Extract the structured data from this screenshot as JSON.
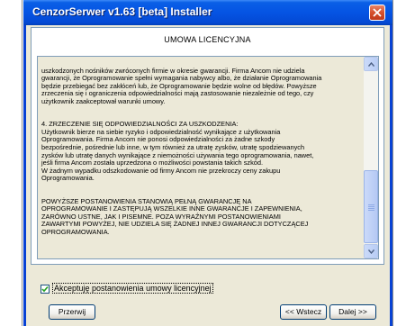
{
  "window": {
    "title": "CenzorSerwer v1.63 [beta] Installer",
    "close_icon": "close-icon"
  },
  "panel": {
    "heading": "UMOWA LICENCYJNA"
  },
  "license": {
    "paragraphs": [
      "uszkodzonych nośników zwróconych firmie w okresie gwarancji. Firma Ancom nie udziela\ngwarancji, że Oprogramowanie spełni wymagania nabywcy albo, że działanie Oprogramowania\nbędzie przebiegać bez zakłóceń lub, że Oprogramowanie będzie wolne od błędów. Powyższe\nzrzeczenia się i ograniczenia odpowiedzialności mają zastosowanie niezależnie od tego, czy\nużytkownik zaakceptował warunki umowy.",
      "4. ZRZECZENIE SIĘ ODPOWIEDZIALNOŚCI ZA USZKODZENIA:\nUżytkownik bierze na siebie ryzyko i odpowiedzialność wynikające z użytkowania\nOprogramowania. Firma Ancom nie ponosi odpowiedzialności za żadne szkody\nbezpośrednie, pośrednie lub inne, w tym również za utratę zysków, utratę spodziewanych\nzysków lub utratę danych wynikające z niemożności używania tego oprogramowania, nawet,\njeśli firma Ancom została uprzedzona o możliwości powstania takich szkód.\nW żadnym wypadku odszkodowanie od firmy Ancom nie przekroczy ceny zakupu\nOprogramowania.",
      "POWYŻSZE POSTANOWIENIA STANOWIĄ PEŁNĄ GWARANCJĘ NA\nOPROGRAMOWANIE I ZASTĘPUJĄ WSZELKIE INNE GWARANCJE I ZAPEWNIENIA,\nZARÓWNO USTNE, JAK I PISEMNE. POZA WYRAŹNYMI POSTANOWIENIAMI\nZAWARTYMI POWYŻEJ, NIE UDZIELA SIĘ ŻADNEJ INNEJ GWARANCJI DOTYCZĄCEJ\nOPROGRAMOWANIA."
    ],
    "scroll_position": 0.72
  },
  "accept": {
    "label": "Akceptuję postanowienia umowy licencyjnej",
    "checked": true
  },
  "buttons": {
    "reset": "Przerwij",
    "back": "<< Wstecz",
    "next": "Dalej >>"
  }
}
